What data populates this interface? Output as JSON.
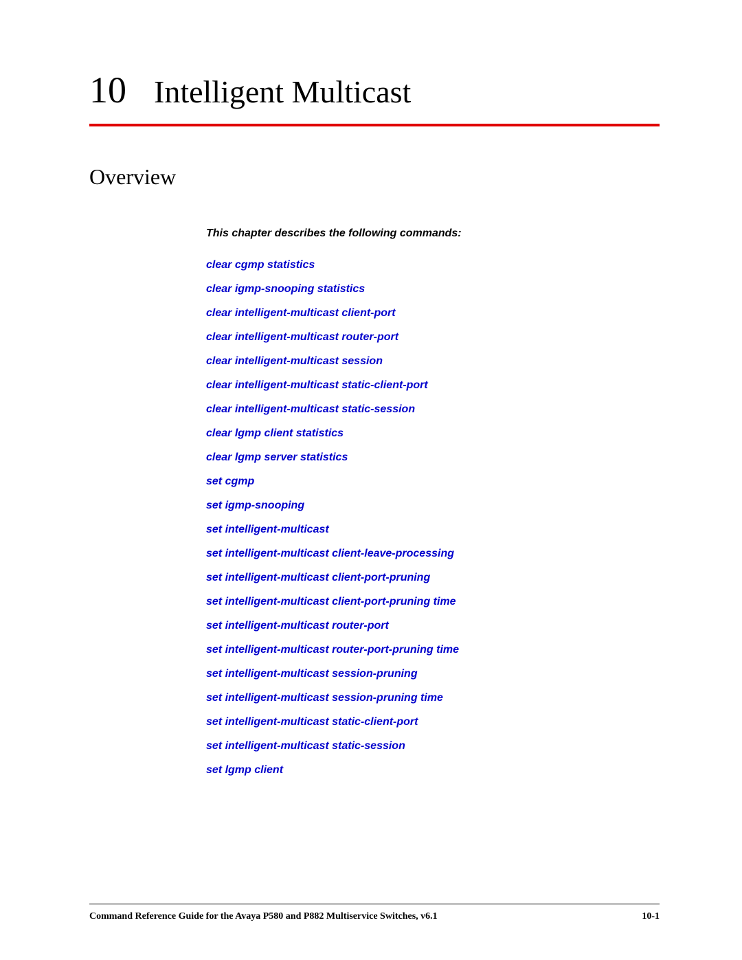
{
  "chapter": {
    "number": "10",
    "title": "Intelligent Multicast"
  },
  "section": {
    "title": "Overview",
    "intro": "This chapter describes the following commands:"
  },
  "commands": [
    "clear cgmp statistics",
    "clear igmp-snooping statistics",
    "clear intelligent-multicast client-port",
    "clear intelligent-multicast router-port",
    "clear intelligent-multicast session",
    "clear intelligent-multicast static-client-port",
    "clear intelligent-multicast static-session",
    "clear lgmp client statistics",
    "clear lgmp server statistics",
    "set cgmp",
    "set igmp-snooping",
    "set intelligent-multicast",
    "set intelligent-multicast client-leave-processing",
    "set intelligent-multicast client-port-pruning",
    "set intelligent-multicast client-port-pruning time",
    "set intelligent-multicast router-port",
    "set intelligent-multicast router-port-pruning time",
    "set intelligent-multicast session-pruning",
    "set intelligent-multicast session-pruning time",
    "set intelligent-multicast static-client-port",
    "set intelligent-multicast static-session",
    "set lgmp client"
  ],
  "footer": {
    "left": "Command Reference Guide for the Avaya P580 and P882 Multiservice Switches, v6.1",
    "right": "10-1"
  }
}
